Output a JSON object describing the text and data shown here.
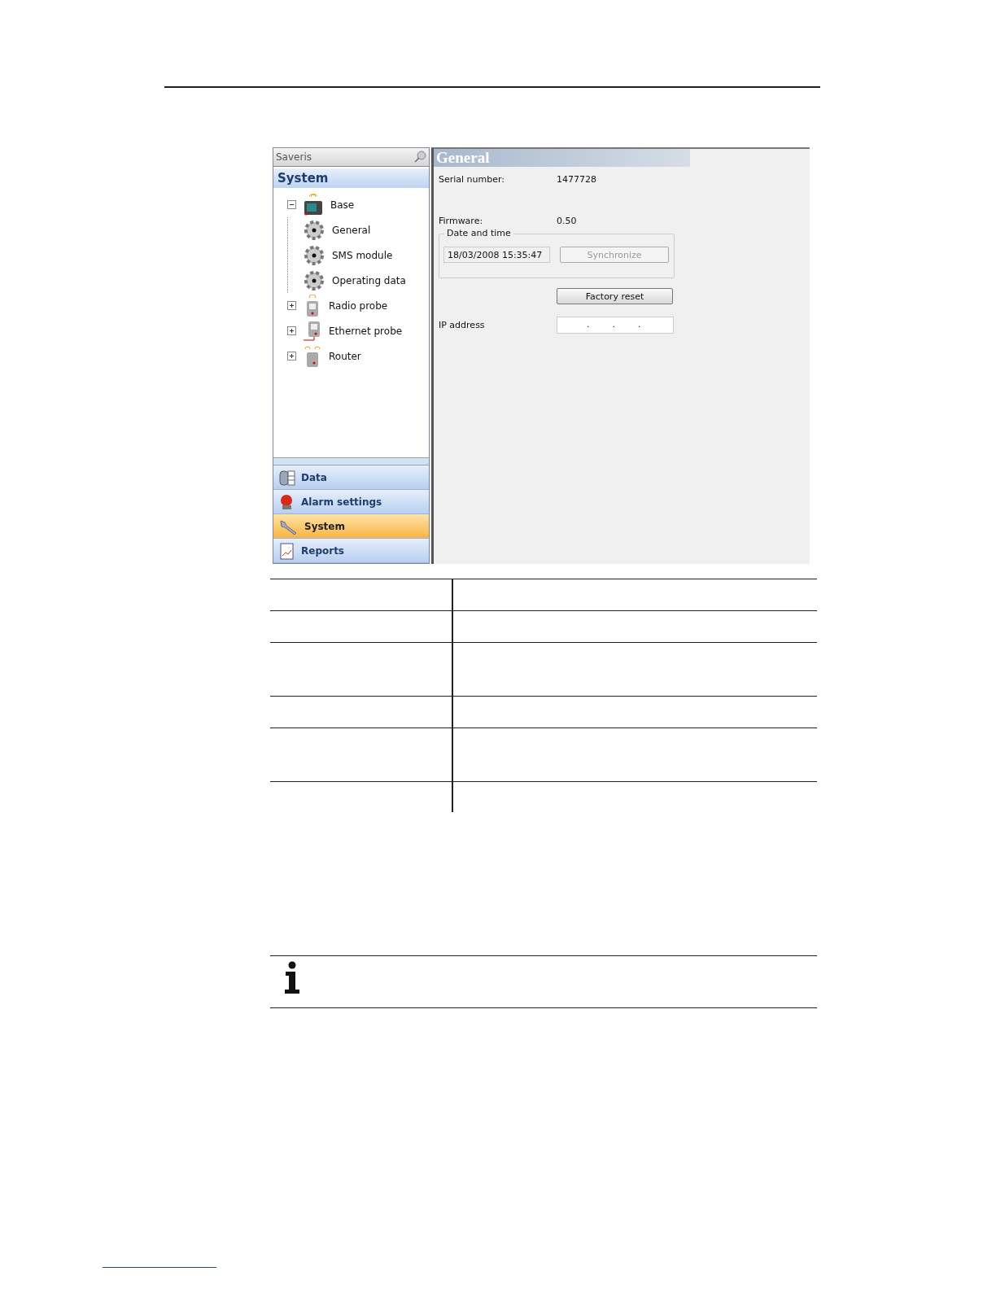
{
  "sidebar": {
    "title": "Saveris",
    "header": "System",
    "tree": [
      {
        "label": "Base",
        "kind": "base",
        "expanded": true,
        "children": [
          {
            "label": "General",
            "kind": "gear"
          },
          {
            "label": "SMS module",
            "kind": "gear"
          },
          {
            "label": "Operating data",
            "kind": "gear"
          }
        ]
      },
      {
        "label": "Radio probe",
        "kind": "radio",
        "expanded": false
      },
      {
        "label": "Ethernet probe",
        "kind": "ethernet",
        "expanded": false
      },
      {
        "label": "Router",
        "kind": "router",
        "expanded": false
      }
    ],
    "nav": [
      {
        "label": "Data",
        "kind": "data",
        "selected": false
      },
      {
        "label": "Alarm settings",
        "kind": "alarm",
        "selected": false
      },
      {
        "label": "System",
        "kind": "wrench",
        "selected": true
      },
      {
        "label": "Reports",
        "kind": "report",
        "selected": false
      }
    ]
  },
  "panel": {
    "title": "General",
    "fields": [
      {
        "label": "Serial number:",
        "value": "1477728"
      },
      {
        "label": "Firmware:",
        "value": "0.50"
      }
    ],
    "date_group": {
      "legend": "Date and time",
      "value": "18/03/2008 15:35:47",
      "button": {
        "label": "Synchronize",
        "disabled": true
      }
    },
    "factory_button": {
      "label": "Factory reset",
      "disabled": false
    },
    "ip": {
      "label": "IP address",
      "value": ".        .        ."
    }
  }
}
